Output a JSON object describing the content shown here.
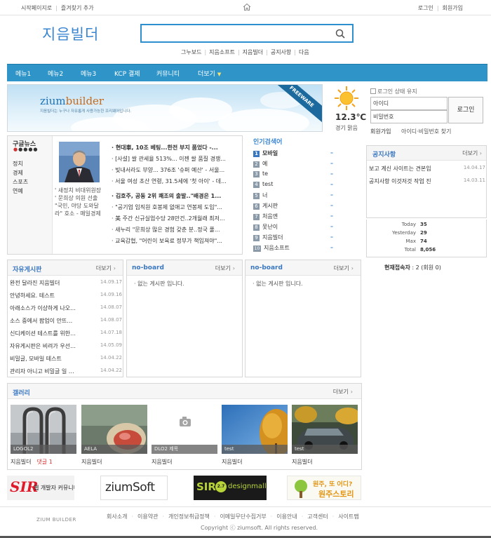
{
  "topbar": {
    "set_home": "시작페이지로",
    "add_favorite": "즐겨찾기 추가",
    "login": "로그인",
    "join": "회원가입"
  },
  "header": {
    "logo": "지음빌더",
    "search_value": "",
    "quicklinks": [
      "그누보드",
      "지음소프트",
      "지음빌더",
      "공지사항",
      "다음"
    ]
  },
  "nav": {
    "items": [
      "메뉴1",
      "메뉴2",
      "메뉴3",
      "KCP 결제",
      "커뮤니티",
      "더보기"
    ]
  },
  "banner": {
    "brand": "zium",
    "brand2": "builder",
    "tagline": "지음빌더는 누구나 자유롭게 사용가능한 프리웨어입니다.",
    "ribbon": "FREEWARE"
  },
  "weather": {
    "temp": "12.3℃",
    "desc": "경기 맑음"
  },
  "login": {
    "keep": "로그인 상태 유지",
    "id_placeholder": "아이디",
    "pw_placeholder": "비밀번호",
    "button": "로그인",
    "join": "회원가입",
    "find": "아이디·비밀번호 찾기"
  },
  "news": {
    "title": "구글뉴스",
    "categories": [
      "정치",
      "경제",
      "스포츠",
      "연예"
    ],
    "caption": "' 새정치 비대위원장 ' 문희상 의원 선출 \"국민, 야당 도와달라\" 호소 - 매일경제",
    "headlines": [
      "· 현대車, 10조 베팅...한전 부지 품었다 -...",
      "· [사설] 쌀 관세율 513%... 이젠 쌀 품질 경쟁...",
      "· 빚내서라도 부양... 376조 '슈퍼 예산' - 서울...",
      "· 서울 여성 초산 연령, 31.5세에 '첫 아이' - 데...",
      "· 김호주, 공동 2위 쾌조의 출발..\"배경은 1...",
      "· \"공기업 임직원 호봉제 없애고 연봉제 도입\"...",
      "· 美 주간 신규실업수당 28만건..2개월래 최저...",
      "· 새누리 \"문희상 많은 경험 갖춘 분..정국 풀...",
      "· 교육감협, \"어린이 보육료 정부가 책임져야\"..."
    ]
  },
  "popular": {
    "title": "인기검색어",
    "items": [
      {
        "rank": "1",
        "word": "모바일"
      },
      {
        "rank": "2",
        "word": "예"
      },
      {
        "rank": "3",
        "word": "te"
      },
      {
        "rank": "4",
        "word": "test"
      },
      {
        "rank": "5",
        "word": "너"
      },
      {
        "rank": "6",
        "word": "게시판"
      },
      {
        "rank": "7",
        "word": "처음엔"
      },
      {
        "rank": "8",
        "word": "못난이"
      },
      {
        "rank": "9",
        "word": "지음빌더"
      },
      {
        "rank": "10",
        "word": "지음소프트"
      }
    ],
    "trend": "–"
  },
  "notice": {
    "title": "공지사항",
    "more": "더보기",
    "items": [
      {
        "title": "보고 계신 사이트는 견본입",
        "date": "14.04.17"
      },
      {
        "title": "공지사항 이것저것 작업 진",
        "date": "14.03.11"
      }
    ]
  },
  "stats": {
    "today_label": "Today",
    "today": "35",
    "yesterday_label": "Yesterday",
    "yesterday": "29",
    "max_label": "Max",
    "max": "74",
    "total_label": "Total",
    "total": "8,056"
  },
  "online": {
    "label": "현재접속자",
    "value": " : 2 (회원 0)"
  },
  "boards": [
    {
      "title": "자유게시판",
      "more": "더보기",
      "items": [
        {
          "title": "완전 달라진 지음빌더",
          "date": "14.09.17"
        },
        {
          "title": "안녕하세요. 테스트",
          "date": "14.09.16"
        },
        {
          "title": "아래소스가 이상하게 나오…",
          "date": "14.08.07"
        },
        {
          "title": "소스 중에서 팝업이 안뜨…",
          "date": "14.08.07"
        },
        {
          "title": "신디케이션 테스트를 위한…",
          "date": "14.07.18"
        },
        {
          "title": "자유게시판은 비려가 우선…",
          "date": "14.05.09"
        },
        {
          "title": "비밀글, 모바일 테스트",
          "date": "14.04.22"
        },
        {
          "title": "관리자 아니고 비밀글 일 …",
          "date": "14.04.22"
        }
      ]
    },
    {
      "title": "no-board",
      "more": "더보기",
      "empty": "· 없는 게시판 입니다."
    },
    {
      "title": "no-board",
      "more": "더보기",
      "empty": "· 없는 게시판 입니다."
    }
  ],
  "gallery": {
    "title": "갤러리",
    "more": "더보기",
    "items": [
      {
        "bar": "LOGOL2",
        "caption": "지음빌더",
        "comment": "댓글 1"
      },
      {
        "bar": "AELA",
        "caption": "지음빌더",
        "comment": ""
      },
      {
        "bar": "DLO2 제목",
        "caption": "지음빌더",
        "comment": ""
      },
      {
        "bar": "test",
        "caption": "지음빌더",
        "comment": ""
      },
      {
        "bar": "test",
        "caption": "지음빌더",
        "comment": ""
      }
    ]
  },
  "partners": {
    "sir": "SIR",
    "sir_sub": "웹 개발자 커뮤니티",
    "ziumsoft": "ziumSoft",
    "designmall": "SIR",
    "designmall_sub": "designmall",
    "story": "원주, 또 어디?",
    "story_sub": "원주스토리"
  },
  "footer": {
    "logo": "ZIUM BUILDER",
    "links": [
      "회사소개",
      "이용약관",
      "개인정보취급정책",
      "이메일무단수집거부",
      "이용안내",
      "고객센터",
      "사이트맵"
    ],
    "copyright": "Copyright ⓒ ziumsoft. All rights reserved."
  },
  "colors": {
    "accent": "#2f95c9",
    "title_blue": "#3a77c1",
    "logo_blue": "#3a86d1"
  }
}
